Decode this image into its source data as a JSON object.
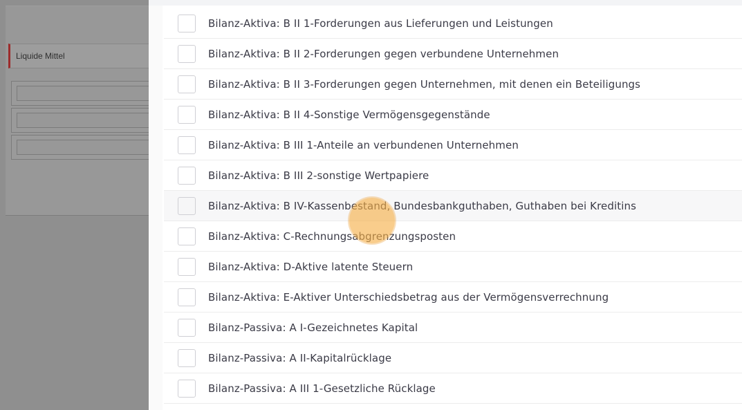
{
  "left_panel": {
    "fields": [
      {
        "value": "Liquide Mittel"
      },
      {
        "value": ""
      },
      {
        "value": ""
      },
      {
        "value": ""
      }
    ]
  },
  "list": {
    "items": [
      {
        "label": "Bilanz-Aktiva: B II 1-Forderungen aus Lieferungen und Leistungen",
        "checked": false
      },
      {
        "label": "Bilanz-Aktiva: B II 2-Forderungen gegen verbundene Unternehmen",
        "checked": false
      },
      {
        "label": "Bilanz-Aktiva: B II 3-Forderungen gegen Unternehmen, mit denen ein Beteiligungs",
        "checked": false
      },
      {
        "label": "Bilanz-Aktiva: B II 4-Sonstige Vermögensgegenstände",
        "checked": false
      },
      {
        "label": "Bilanz-Aktiva: B III 1-Anteile an verbundenen Unternehmen",
        "checked": false
      },
      {
        "label": "Bilanz-Aktiva: B III 2-sonstige Wertpapiere",
        "checked": false
      },
      {
        "label": "Bilanz-Aktiva: B IV-Kassenbestand, Bundesbankguthaben, Guthaben bei Kreditins",
        "checked": false
      },
      {
        "label": "Bilanz-Aktiva: C-Rechnungsabgrenzungsposten",
        "checked": false
      },
      {
        "label": "Bilanz-Aktiva: D-Aktive latente Steuern",
        "checked": false
      },
      {
        "label": "Bilanz-Aktiva: E-Aktiver Unterschiedsbetrag aus der Vermögensverrechnung",
        "checked": false
      },
      {
        "label": "Bilanz-Passiva: A I-Gezeichnetes Kapital",
        "checked": false
      },
      {
        "label": "Bilanz-Passiva: A II-Kapitalrücklage",
        "checked": false
      },
      {
        "label": "Bilanz-Passiva: A III 1-Gesetzliche Rücklage",
        "checked": false
      }
    ]
  },
  "colors": {
    "overlay": "#8f8f8f",
    "field_accent": "#9c2b2b",
    "click_indicator": "#f5af46",
    "row_border": "#ececec"
  }
}
